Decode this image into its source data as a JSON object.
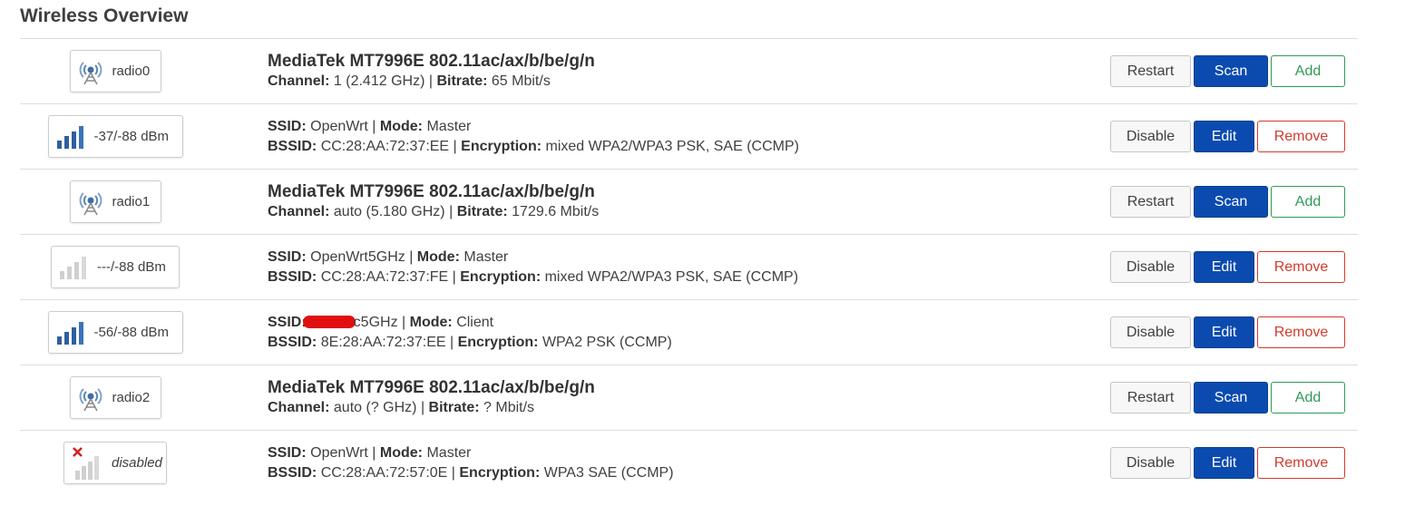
{
  "title": "Wireless Overview",
  "labels": {
    "ssid": "SSID:",
    "mode": "Mode:",
    "bssid": "BSSID:",
    "encryption": "Encryption:",
    "channel": "Channel:",
    "bitrate": "Bitrate:",
    "sep": " | "
  },
  "buttons": {
    "restart": "Restart",
    "scan": "Scan",
    "add": "Add",
    "disable": "Disable",
    "edit": "Edit",
    "remove": "Remove"
  },
  "radios": [
    {
      "badge": "radio0",
      "icon": "wifi-antenna-icon",
      "name": "MediaTek MT7996E 802.11ac/ax/b/be/g/n",
      "channel": "1 (2.412 GHz)",
      "bitrate": "65 Mbit/s",
      "networks": [
        {
          "badge": "-37/-88 dBm",
          "icon": "signal-strong-icon",
          "ssid": "OpenWrt",
          "mode": "Master",
          "bssid": "CC:28:AA:72:37:EE",
          "encryption": "mixed WPA2/WPA3 PSK, SAE (CCMP)"
        }
      ]
    },
    {
      "badge": "radio1",
      "icon": "wifi-antenna-icon",
      "name": "MediaTek MT7996E 802.11ac/ax/b/be/g/n",
      "channel": "auto (5.180 GHz)",
      "bitrate": "1729.6 Mbit/s",
      "networks": [
        {
          "badge": "---/-88 dBm",
          "icon": "signal-none-icon",
          "ssid": "OpenWrt5GHz",
          "mode": "Master",
          "bssid": "CC:28:AA:72:37:FE",
          "encryption": "mixed WPA2/WPA3 PSK, SAE (CCMP)"
        },
        {
          "badge": "-56/-88 dBm",
          "icon": "signal-strong-icon",
          "ssid_suffix": "c5GHz",
          "mode": "Client",
          "bssid": "8E:28:AA:72:37:EE",
          "encryption": "WPA2 PSK (CCMP)"
        }
      ]
    },
    {
      "badge": "radio2",
      "icon": "wifi-antenna-icon",
      "name": "MediaTek MT7996E 802.11ac/ax/b/be/g/n",
      "channel": "auto (? GHz)",
      "bitrate": "? Mbit/s",
      "networks": [
        {
          "badge": "disabled",
          "icon": "signal-disabled-icon",
          "ssid": "OpenWrt",
          "mode": "Master",
          "bssid": "CC:28:AA:72:57:0E",
          "encryption": "WPA3 SAE (CCMP)"
        }
      ]
    }
  ]
}
